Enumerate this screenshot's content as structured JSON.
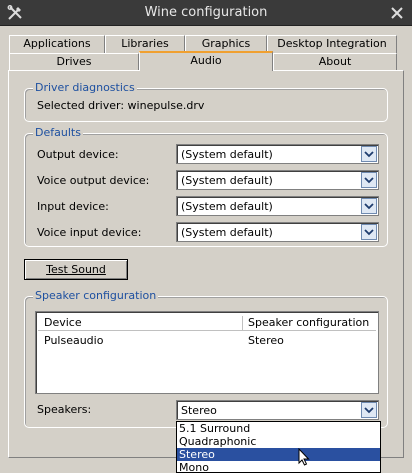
{
  "window": {
    "title": "Wine configuration"
  },
  "tabs": {
    "row1": [
      "Applications",
      "Libraries",
      "Graphics",
      "Desktop Integration"
    ],
    "row2": [
      "Drives",
      "Audio",
      "About"
    ],
    "active": "Audio"
  },
  "driver": {
    "group_title": "Driver diagnostics",
    "selected_text": "Selected driver: winepulse.drv"
  },
  "defaults": {
    "group_title": "Defaults",
    "rows": [
      {
        "label": "Output device:",
        "value": "(System default)"
      },
      {
        "label": "Voice output device:",
        "value": "(System default)"
      },
      {
        "label": "Input device:",
        "value": "(System default)"
      },
      {
        "label": "Voice input device:",
        "value": "(System default)"
      }
    ]
  },
  "test_sound_label": "Test Sound",
  "speaker": {
    "group_title": "Speaker configuration",
    "columns": [
      "Device",
      "Speaker configuration"
    ],
    "rows": [
      {
        "device": "Pulseaudio",
        "config": "Stereo"
      }
    ],
    "speakers_label": "Speakers:",
    "speakers_value": "Stereo",
    "options": [
      "5.1 Surround",
      "Quadraphonic",
      "Stereo",
      "Mono"
    ],
    "selected_option": "Stereo"
  },
  "icons": {
    "app": "tools-icon",
    "close": "close-icon",
    "combo_arrow": "chevron-down-icon"
  },
  "colors": {
    "titlebar": "#3a3a3a",
    "window_bg": "#d4d0c8",
    "group_title": "#1e50a0",
    "tab_active_accent": "#f0a030",
    "selection": "#2a50a0"
  }
}
